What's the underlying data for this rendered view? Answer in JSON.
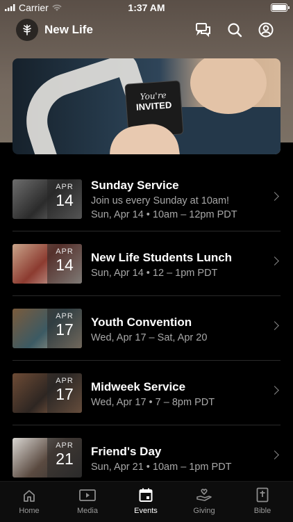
{
  "status": {
    "carrier": "Carrier",
    "time": "1:37 AM"
  },
  "header": {
    "title": "New Life"
  },
  "banner": {
    "card_line1": "You're",
    "card_line2": "INVITED"
  },
  "events": [
    {
      "month": "APR",
      "day": "14",
      "title": "Sunday Service",
      "lines": [
        "Join us every Sunday at 10am!",
        "Sun, Apr 14 • 10am – 12pm PDT"
      ]
    },
    {
      "month": "APR",
      "day": "14",
      "title": "New Life Students Lunch",
      "lines": [
        "Sun, Apr 14 • 12 – 1pm PDT"
      ]
    },
    {
      "month": "APR",
      "day": "17",
      "title": "Youth Convention",
      "lines": [
        "Wed, Apr 17 – Sat, Apr 20"
      ]
    },
    {
      "month": "APR",
      "day": "17",
      "title": "Midweek Service",
      "lines": [
        "Wed, Apr 17 • 7 – 8pm PDT"
      ]
    },
    {
      "month": "APR",
      "day": "21",
      "title": "Friend's Day",
      "lines": [
        "Sun, Apr 21 • 10am – 1pm PDT"
      ]
    }
  ],
  "tabs": [
    {
      "label": "Home",
      "icon": "home-icon",
      "active": false
    },
    {
      "label": "Media",
      "icon": "media-icon",
      "active": false
    },
    {
      "label": "Events",
      "icon": "calendar-icon",
      "active": true
    },
    {
      "label": "Giving",
      "icon": "giving-icon",
      "active": false
    },
    {
      "label": "Bible",
      "icon": "bible-icon",
      "active": false
    }
  ]
}
